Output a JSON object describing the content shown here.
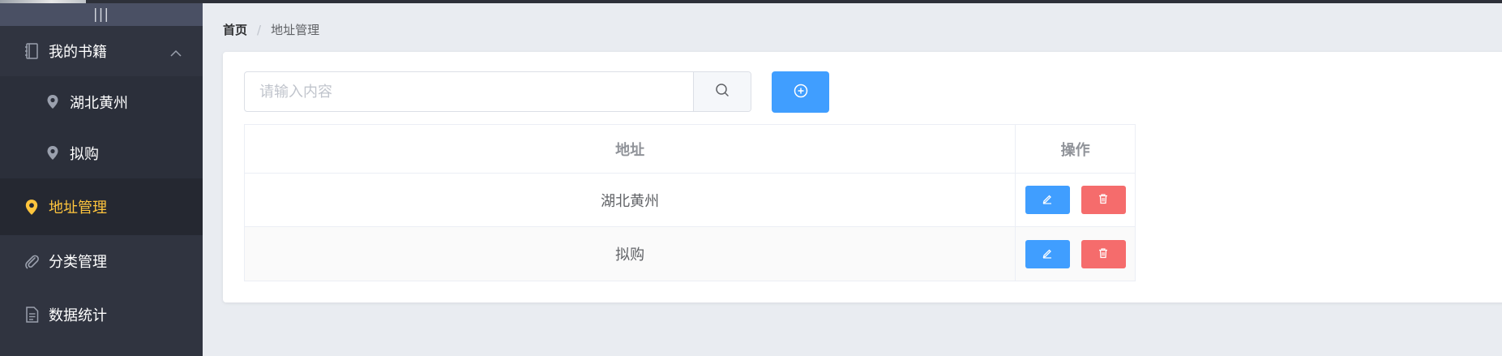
{
  "sidebar": {
    "toggle_label": "|||",
    "items": [
      {
        "label": "我的书籍",
        "icon": "notebook-icon"
      },
      {
        "label": "湖北黄州",
        "icon": "location-pin-icon"
      },
      {
        "label": "拟购",
        "icon": "location-pin-icon"
      },
      {
        "label": "地址管理",
        "icon": "location-pin-icon"
      },
      {
        "label": "分类管理",
        "icon": "paperclip-icon"
      },
      {
        "label": "数据统计",
        "icon": "document-icon"
      }
    ]
  },
  "breadcrumb": {
    "home": "首页",
    "separator": "/",
    "current": "地址管理"
  },
  "search": {
    "placeholder": "请输入内容",
    "value": ""
  },
  "table": {
    "headers": [
      "地址",
      "操作"
    ],
    "rows": [
      {
        "address": "湖北黄州"
      },
      {
        "address": "拟购"
      }
    ]
  },
  "colors": {
    "sidebar_bg": "#303440",
    "active_text": "#ffc53d",
    "primary": "#409eff",
    "danger": "#f56c6c"
  }
}
